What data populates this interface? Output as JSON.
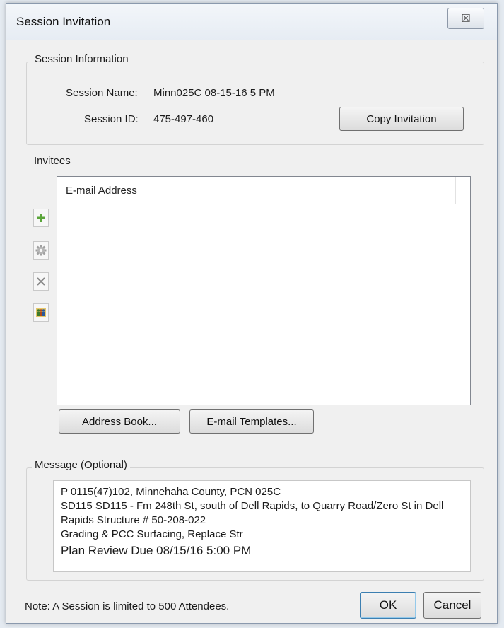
{
  "window": {
    "title": "Session Invitation",
    "close_glyph": "☒"
  },
  "session_info": {
    "group_label": "Session Information",
    "name_label": "Session Name:",
    "name_value": "Minn025C 08-15-16 5 PM",
    "id_label": "Session ID:",
    "id_value": "475-497-460",
    "copy_button": "Copy Invitation"
  },
  "invitees": {
    "group_label": "Invitees",
    "column_header": "E-mail Address",
    "rows": [],
    "tools": [
      {
        "name": "add-icon",
        "color": "#5aa53a"
      },
      {
        "name": "gear-icon",
        "color": "#9a9a9a"
      },
      {
        "name": "delete-icon",
        "color": "#8a8a8a"
      },
      {
        "name": "people-icon",
        "color": "#d9a018"
      }
    ],
    "address_book_button": "Address Book...",
    "email_templates_button": "E-mail Templates..."
  },
  "message": {
    "group_label": "Message (Optional)",
    "lines": [
      "P 0115(47)102, Minnehaha County, PCN 025C",
      "SD115 SD115 - Fm 248th St, south of Dell Rapids, to Quarry Road/Zero St in Dell",
      "Rapids Structure # 50-208-022",
      "Grading & PCC Surfacing, Replace Str",
      "Plan Review Due 08/15/16 5:00 PM"
    ]
  },
  "footer": {
    "note": "Note: A Session is limited to 500 Attendees.",
    "ok_button": "OK",
    "cancel_button": "Cancel"
  }
}
